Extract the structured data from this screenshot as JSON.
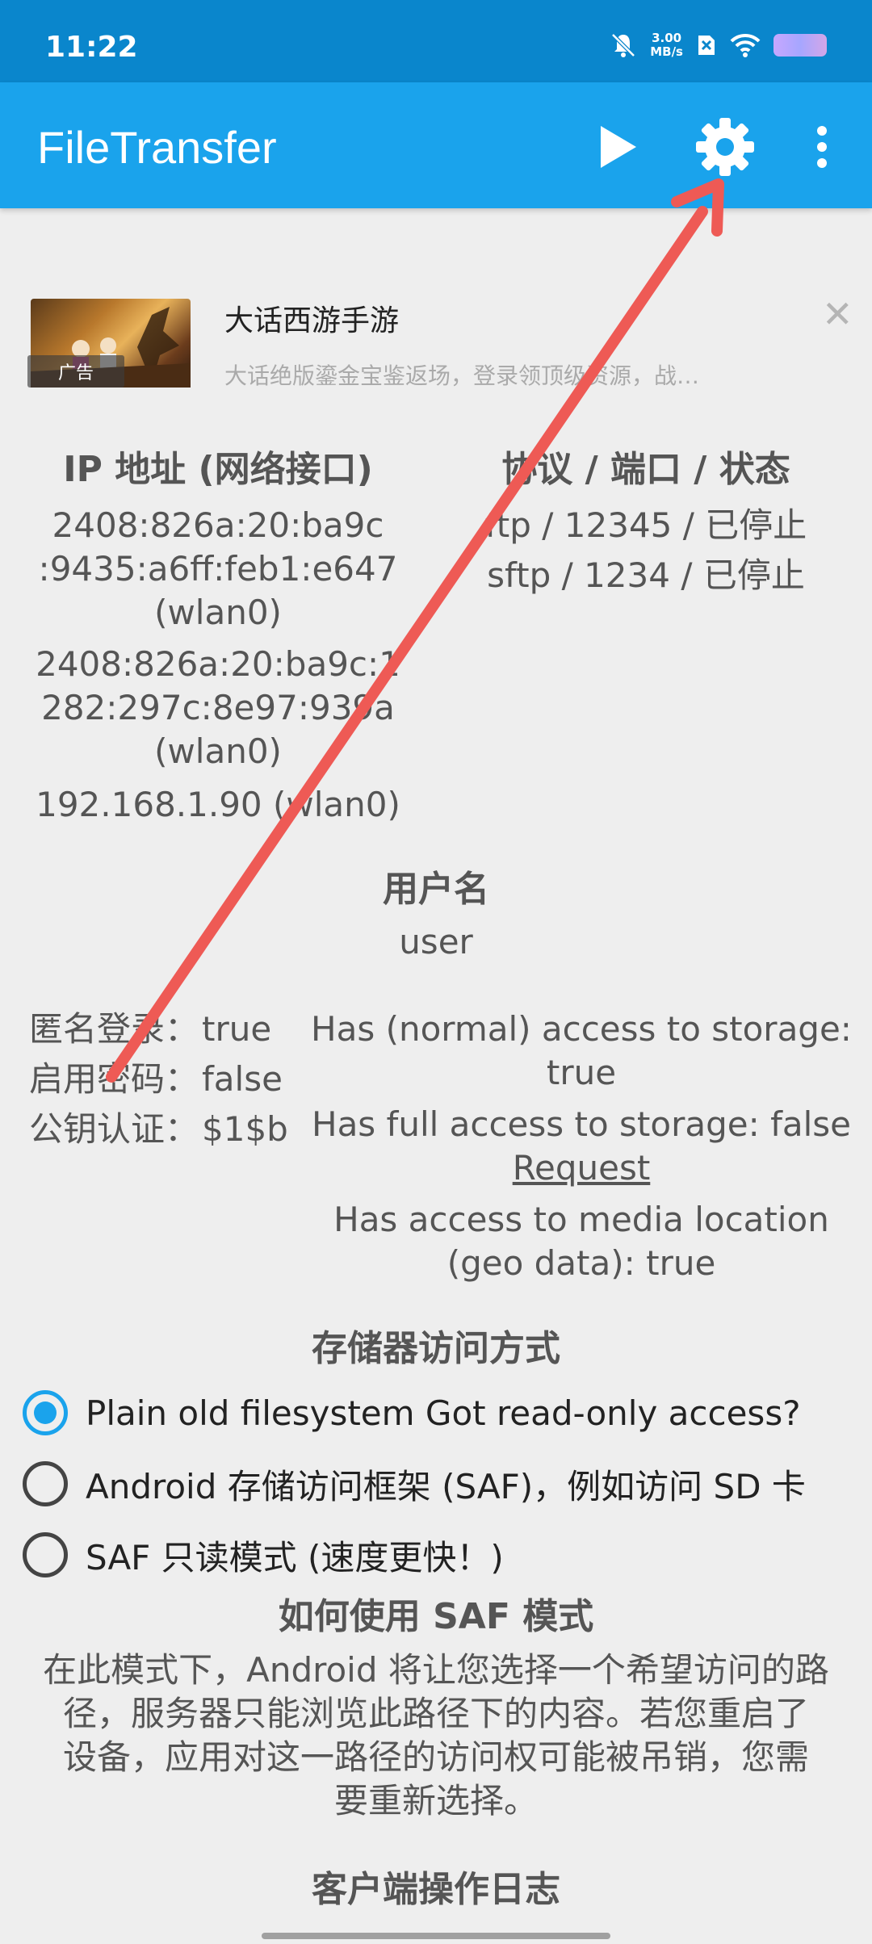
{
  "status": {
    "time": "11:22",
    "speed_value": "3.00",
    "speed_unit": "MB/s",
    "icons": [
      "mute-icon",
      "speed-readout",
      "sim-x-icon",
      "wifi-icon",
      "battery-icon"
    ]
  },
  "appbar": {
    "title": "FileTransfer",
    "icons": [
      "play-icon",
      "gear-icon",
      "overflow-menu-icon"
    ],
    "color": "#1aa3ec"
  },
  "ad": {
    "title": "大话西游手游",
    "description": "大话绝版鎏金宝鉴返场，登录领顶级资源，战…",
    "badge": "广告",
    "close_icon": "close-icon"
  },
  "network": {
    "ip_header": "IP 地址 (网络接口)",
    "ip_lines": [
      "2408:826a:20:ba9c",
      ":9435:a6ff:feb1:e647",
      "(wlan0)",
      "2408:826a:20:ba9c:1",
      "282:297c:8e97:939a",
      "(wlan0)",
      "192.168.1.90 (wlan0)"
    ],
    "protocol_header": "协议 / 端口 / 状态",
    "protocols": [
      "ftp / 12345 / 已停止",
      "sftp / 1234 / 已停止"
    ]
  },
  "user": {
    "label": "用户名",
    "value": "user"
  },
  "auth": {
    "anonymous_label": "匿名登录：",
    "anonymous_value": "true",
    "password_label": "启用密码：",
    "password_value": "false",
    "pubkey_label": "公钥认证：",
    "pubkey_value": "$1$b"
  },
  "storage_access": {
    "normal_line1": "Has (normal) access to storage:",
    "normal_line2": "true",
    "full": "Has full access to storage: false",
    "request_link": "Request",
    "media_line1": "Has access to media location",
    "media_line2": "(geo data): true"
  },
  "storage_mode": {
    "header": "存储器访问方式",
    "options": [
      {
        "label": "Plain old filesystem Got read-only access?",
        "selected": true
      },
      {
        "label": "Android 存储访问框架 (SAF)，例如访问 SD 卡",
        "selected": false
      },
      {
        "label": "SAF 只读模式 (速度更快！)",
        "selected": false
      }
    ]
  },
  "saf_help": {
    "header": "如何使用 SAF 模式",
    "lines": [
      "在此模式下，Android 将让您选择一个希望访问的路",
      "径，服务器只能浏览此路径下的内容。若您重启了",
      "设备，应用对这一路径的访问权可能被吊销，您需",
      "要重新选择。"
    ]
  },
  "log": {
    "header": "客户端操作日志"
  },
  "annotation": {
    "arrow_color": "#ee5a55"
  }
}
